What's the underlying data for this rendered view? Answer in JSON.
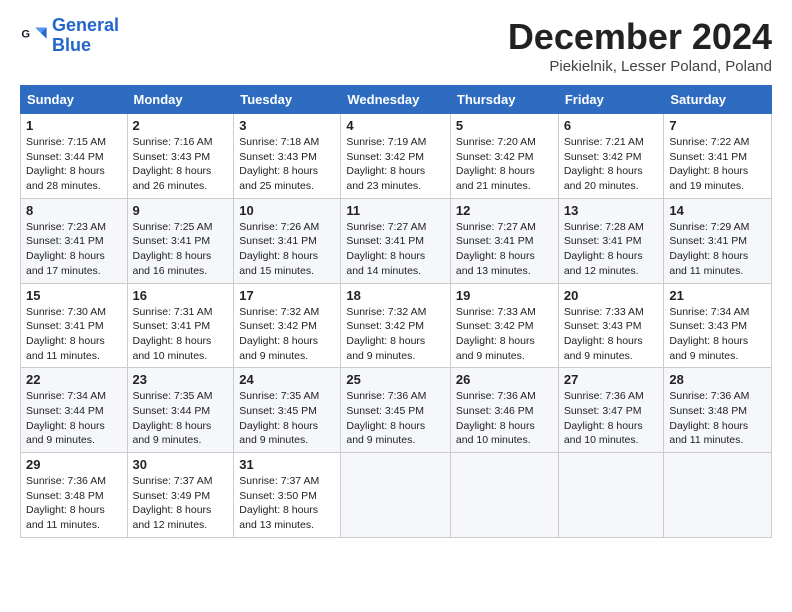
{
  "logo": {
    "line1": "General",
    "line2": "Blue"
  },
  "title": "December 2024",
  "location": "Piekielnik, Lesser Poland, Poland",
  "days_of_week": [
    "Sunday",
    "Monday",
    "Tuesday",
    "Wednesday",
    "Thursday",
    "Friday",
    "Saturday"
  ],
  "weeks": [
    [
      {
        "day": "1",
        "sunrise": "Sunrise: 7:15 AM",
        "sunset": "Sunset: 3:44 PM",
        "daylight": "Daylight: 8 hours and 28 minutes."
      },
      {
        "day": "2",
        "sunrise": "Sunrise: 7:16 AM",
        "sunset": "Sunset: 3:43 PM",
        "daylight": "Daylight: 8 hours and 26 minutes."
      },
      {
        "day": "3",
        "sunrise": "Sunrise: 7:18 AM",
        "sunset": "Sunset: 3:43 PM",
        "daylight": "Daylight: 8 hours and 25 minutes."
      },
      {
        "day": "4",
        "sunrise": "Sunrise: 7:19 AM",
        "sunset": "Sunset: 3:42 PM",
        "daylight": "Daylight: 8 hours and 23 minutes."
      },
      {
        "day": "5",
        "sunrise": "Sunrise: 7:20 AM",
        "sunset": "Sunset: 3:42 PM",
        "daylight": "Daylight: 8 hours and 21 minutes."
      },
      {
        "day": "6",
        "sunrise": "Sunrise: 7:21 AM",
        "sunset": "Sunset: 3:42 PM",
        "daylight": "Daylight: 8 hours and 20 minutes."
      },
      {
        "day": "7",
        "sunrise": "Sunrise: 7:22 AM",
        "sunset": "Sunset: 3:41 PM",
        "daylight": "Daylight: 8 hours and 19 minutes."
      }
    ],
    [
      {
        "day": "8",
        "sunrise": "Sunrise: 7:23 AM",
        "sunset": "Sunset: 3:41 PM",
        "daylight": "Daylight: 8 hours and 17 minutes."
      },
      {
        "day": "9",
        "sunrise": "Sunrise: 7:25 AM",
        "sunset": "Sunset: 3:41 PM",
        "daylight": "Daylight: 8 hours and 16 minutes."
      },
      {
        "day": "10",
        "sunrise": "Sunrise: 7:26 AM",
        "sunset": "Sunset: 3:41 PM",
        "daylight": "Daylight: 8 hours and 15 minutes."
      },
      {
        "day": "11",
        "sunrise": "Sunrise: 7:27 AM",
        "sunset": "Sunset: 3:41 PM",
        "daylight": "Daylight: 8 hours and 14 minutes."
      },
      {
        "day": "12",
        "sunrise": "Sunrise: 7:27 AM",
        "sunset": "Sunset: 3:41 PM",
        "daylight": "Daylight: 8 hours and 13 minutes."
      },
      {
        "day": "13",
        "sunrise": "Sunrise: 7:28 AM",
        "sunset": "Sunset: 3:41 PM",
        "daylight": "Daylight: 8 hours and 12 minutes."
      },
      {
        "day": "14",
        "sunrise": "Sunrise: 7:29 AM",
        "sunset": "Sunset: 3:41 PM",
        "daylight": "Daylight: 8 hours and 11 minutes."
      }
    ],
    [
      {
        "day": "15",
        "sunrise": "Sunrise: 7:30 AM",
        "sunset": "Sunset: 3:41 PM",
        "daylight": "Daylight: 8 hours and 11 minutes."
      },
      {
        "day": "16",
        "sunrise": "Sunrise: 7:31 AM",
        "sunset": "Sunset: 3:41 PM",
        "daylight": "Daylight: 8 hours and 10 minutes."
      },
      {
        "day": "17",
        "sunrise": "Sunrise: 7:32 AM",
        "sunset": "Sunset: 3:42 PM",
        "daylight": "Daylight: 8 hours and 9 minutes."
      },
      {
        "day": "18",
        "sunrise": "Sunrise: 7:32 AM",
        "sunset": "Sunset: 3:42 PM",
        "daylight": "Daylight: 8 hours and 9 minutes."
      },
      {
        "day": "19",
        "sunrise": "Sunrise: 7:33 AM",
        "sunset": "Sunset: 3:42 PM",
        "daylight": "Daylight: 8 hours and 9 minutes."
      },
      {
        "day": "20",
        "sunrise": "Sunrise: 7:33 AM",
        "sunset": "Sunset: 3:43 PM",
        "daylight": "Daylight: 8 hours and 9 minutes."
      },
      {
        "day": "21",
        "sunrise": "Sunrise: 7:34 AM",
        "sunset": "Sunset: 3:43 PM",
        "daylight": "Daylight: 8 hours and 9 minutes."
      }
    ],
    [
      {
        "day": "22",
        "sunrise": "Sunrise: 7:34 AM",
        "sunset": "Sunset: 3:44 PM",
        "daylight": "Daylight: 8 hours and 9 minutes."
      },
      {
        "day": "23",
        "sunrise": "Sunrise: 7:35 AM",
        "sunset": "Sunset: 3:44 PM",
        "daylight": "Daylight: 8 hours and 9 minutes."
      },
      {
        "day": "24",
        "sunrise": "Sunrise: 7:35 AM",
        "sunset": "Sunset: 3:45 PM",
        "daylight": "Daylight: 8 hours and 9 minutes."
      },
      {
        "day": "25",
        "sunrise": "Sunrise: 7:36 AM",
        "sunset": "Sunset: 3:45 PM",
        "daylight": "Daylight: 8 hours and 9 minutes."
      },
      {
        "day": "26",
        "sunrise": "Sunrise: 7:36 AM",
        "sunset": "Sunset: 3:46 PM",
        "daylight": "Daylight: 8 hours and 10 minutes."
      },
      {
        "day": "27",
        "sunrise": "Sunrise: 7:36 AM",
        "sunset": "Sunset: 3:47 PM",
        "daylight": "Daylight: 8 hours and 10 minutes."
      },
      {
        "day": "28",
        "sunrise": "Sunrise: 7:36 AM",
        "sunset": "Sunset: 3:48 PM",
        "daylight": "Daylight: 8 hours and 11 minutes."
      }
    ],
    [
      {
        "day": "29",
        "sunrise": "Sunrise: 7:36 AM",
        "sunset": "Sunset: 3:48 PM",
        "daylight": "Daylight: 8 hours and 11 minutes."
      },
      {
        "day": "30",
        "sunrise": "Sunrise: 7:37 AM",
        "sunset": "Sunset: 3:49 PM",
        "daylight": "Daylight: 8 hours and 12 minutes."
      },
      {
        "day": "31",
        "sunrise": "Sunrise: 7:37 AM",
        "sunset": "Sunset: 3:50 PM",
        "daylight": "Daylight: 8 hours and 13 minutes."
      },
      null,
      null,
      null,
      null
    ]
  ]
}
